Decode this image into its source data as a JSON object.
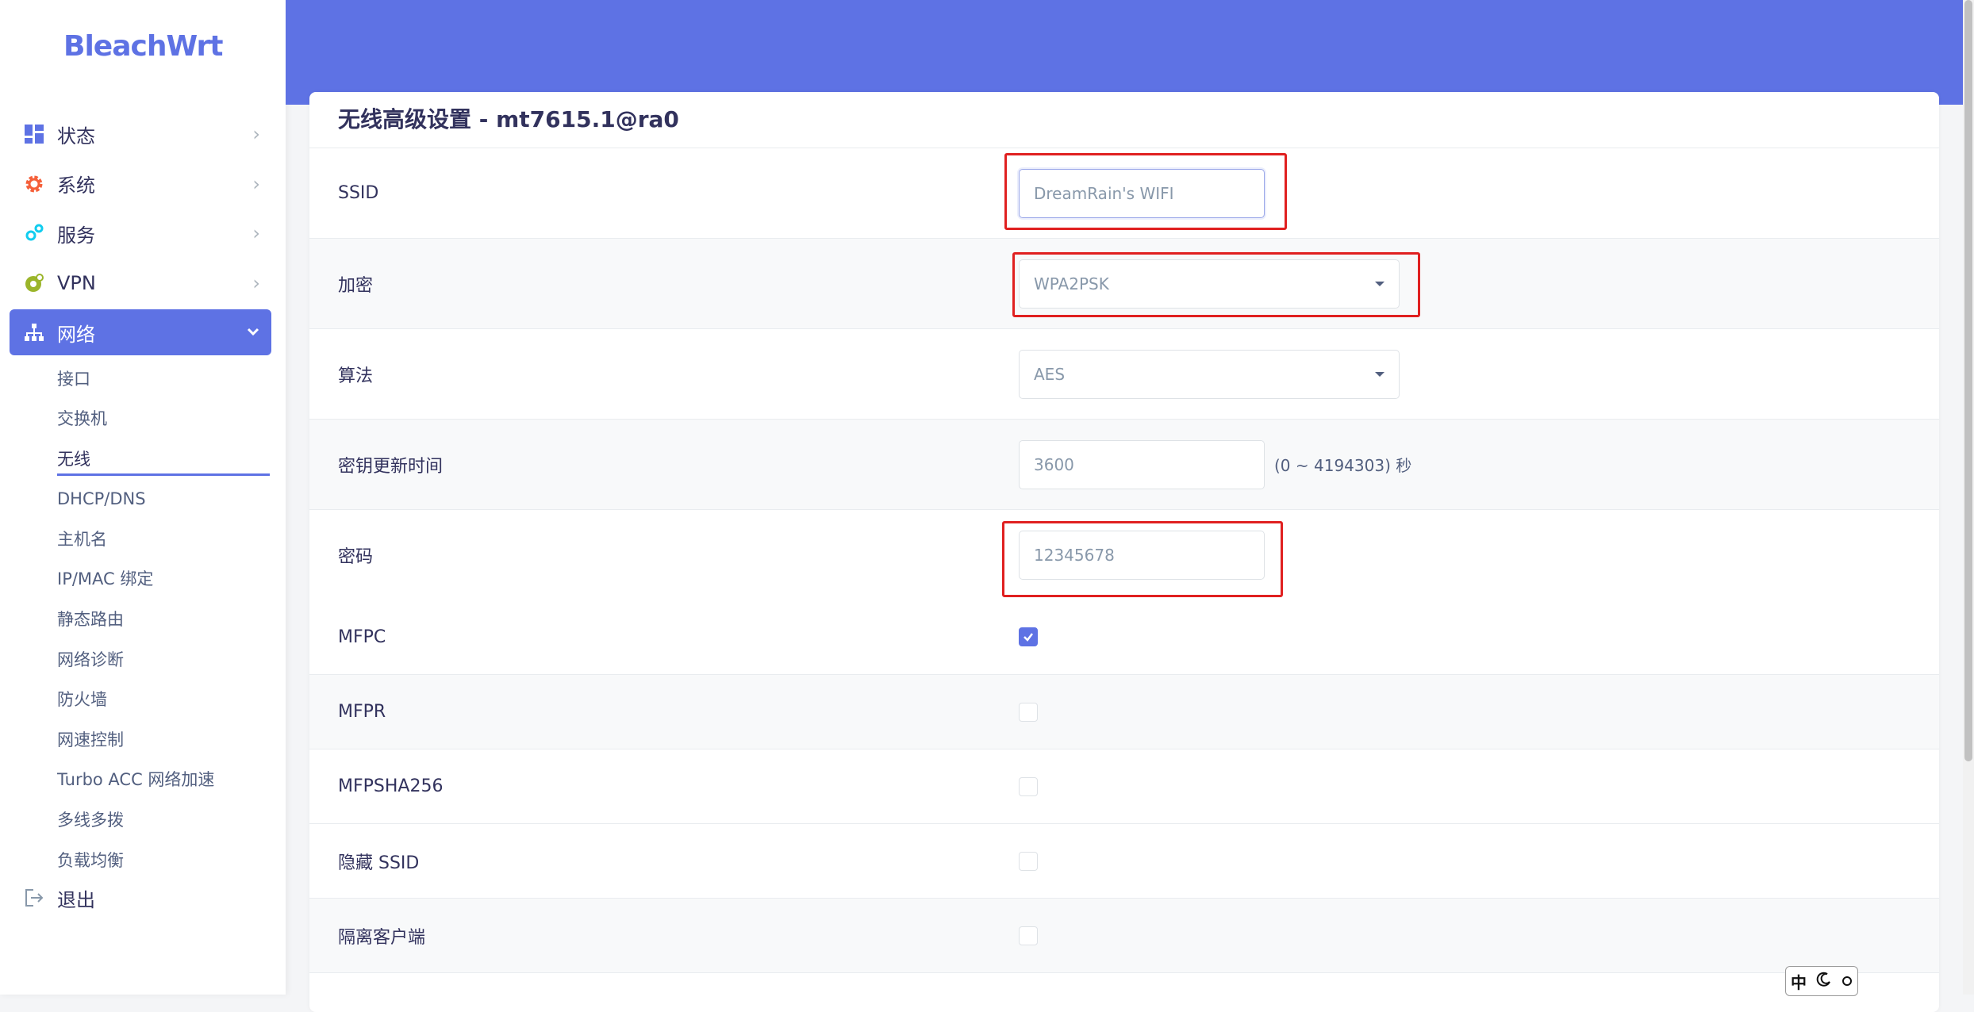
{
  "brand": {
    "name": "BleachWrt"
  },
  "menu": [
    {
      "label": "状态",
      "icon": "dashboard-icon"
    },
    {
      "label": "系统",
      "icon": "gear-icon"
    },
    {
      "label": "服务",
      "icon": "cogs-icon"
    },
    {
      "label": "VPN",
      "icon": "globe-icon"
    },
    {
      "label": "网络",
      "icon": "network-icon"
    }
  ],
  "submenu": [
    "接口",
    "交换机",
    "无线",
    "DHCP/DNS",
    "主机名",
    "IP/MAC 绑定",
    "静态路由",
    "网络诊断",
    "防火墙",
    "网速控制",
    "Turbo ACC 网络加速",
    "多线多拨",
    "负载均衡"
  ],
  "logout": {
    "label": "退出"
  },
  "card": {
    "title": "无线高级设置 - mt7615.1@ra0",
    "rows": {
      "ssid": {
        "label": "SSID",
        "value": "DreamRain's WIFI"
      },
      "encryption": {
        "label": "加密",
        "value": "WPA2PSK"
      },
      "algorithm": {
        "label": "算法",
        "value": "AES"
      },
      "rekey": {
        "label": "密钥更新时间",
        "value": "3600",
        "hint": "(0 ~ 4194303) 秒"
      },
      "password": {
        "label": "密码",
        "value": "12345678"
      },
      "mfpc": {
        "label": "MFPC",
        "checked": true
      },
      "mfpr": {
        "label": "MFPR",
        "checked": false
      },
      "mfpsha256": {
        "label": "MFPSHA256",
        "checked": false
      },
      "hide_ssid": {
        "label": "隐藏 SSID",
        "checked": false
      },
      "isolate": {
        "label": "隔离客户端",
        "checked": false
      }
    }
  },
  "ime": {
    "mode": "中"
  },
  "colors": {
    "accent": "#5e72e4",
    "highlight": "#e02020"
  }
}
